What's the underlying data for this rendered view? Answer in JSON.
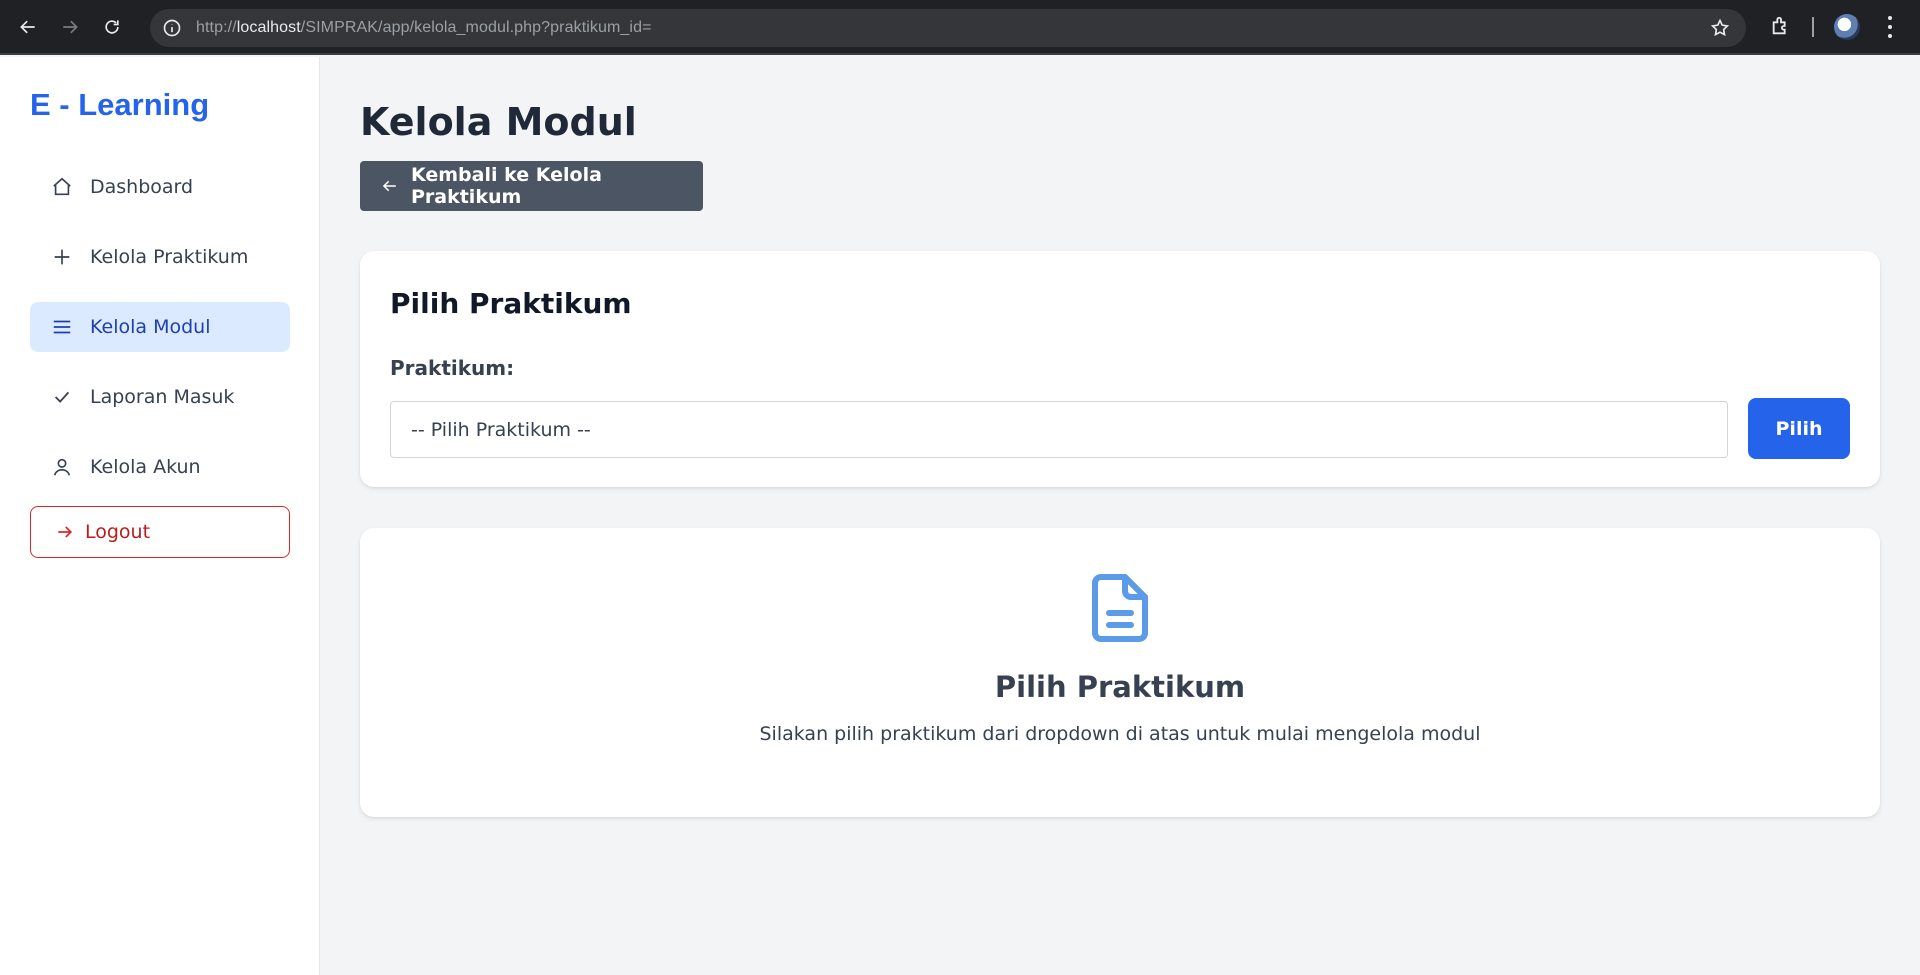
{
  "browser": {
    "url_scheme": "http://",
    "url_host": "localhost",
    "url_path": "/SIMPRAK/app/kelola_modul.php?praktikum_id="
  },
  "sidebar": {
    "brand": "E - Learning",
    "items": [
      {
        "label": "Dashboard",
        "icon": "home-icon",
        "active": false
      },
      {
        "label": "Kelola Praktikum",
        "icon": "plus-icon",
        "active": false
      },
      {
        "label": "Kelola Modul",
        "icon": "list-icon",
        "active": true
      },
      {
        "label": "Laporan Masuk",
        "icon": "check-icon",
        "active": false
      },
      {
        "label": "Kelola Akun",
        "icon": "user-icon",
        "active": false
      }
    ],
    "logout_label": "Logout"
  },
  "main": {
    "title": "Kelola Modul",
    "back_label": "Kembali ke Kelola Praktikum",
    "select_card": {
      "title": "Pilih Praktikum",
      "field_label": "Praktikum:",
      "selected_option": "-- Pilih Praktikum --",
      "submit_label": "Pilih"
    },
    "empty_state": {
      "icon": "document-icon",
      "title": "Pilih Praktikum",
      "description": "Silakan pilih praktikum dari dropdown di atas untuk mulai mengelola modul"
    }
  },
  "colors": {
    "accent": "#2563eb",
    "active_bg": "#dbeafe",
    "logout": "#dc2626",
    "back_button": "#4b5563"
  }
}
